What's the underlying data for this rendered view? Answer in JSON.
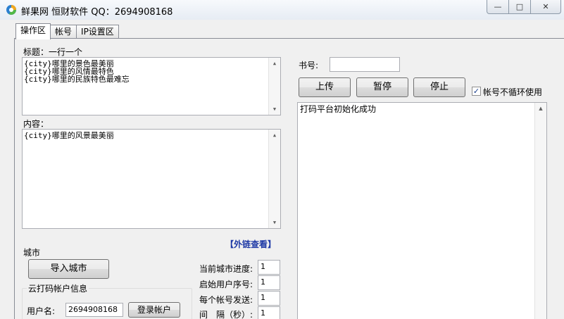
{
  "window": {
    "title": "鲜果网 恒财软件 QQ：2694908168",
    "minimize": "—",
    "maximize": "□",
    "close": "✕"
  },
  "tabs": [
    "操作区",
    "帐号",
    "IP设置区"
  ],
  "left": {
    "title_label": "标题：一行一个",
    "title_lines": [
      "{city}哪里的景色最美丽",
      "{city}哪里的风情最特色",
      "{city}哪里的民族特色最难忘"
    ],
    "content_label": "内容：",
    "content_lines": [
      "{city}哪里的风景最美丽"
    ],
    "external_link": "【外链查看】",
    "city_label": "城市",
    "import_city_button": "导入城市",
    "cloud_account_label": "云打码帐户信息",
    "username_label": "用户名:",
    "username_value": "2694908168",
    "login_button": "登录帐户",
    "progress_label": "当前城市进度:",
    "progress_value": "1",
    "start_user_label": "启始用户序号:",
    "start_user_value": "1",
    "per_account_label": "每个帐号发送:",
    "per_account_value": "1",
    "interval_label": "间　隔（秒）:",
    "interval_value": "1"
  },
  "right": {
    "book_label": "书号:",
    "book_value": "",
    "upload_button": "上传",
    "pause_button": "暂停",
    "stop_button": "停止",
    "no_loop_label": "帐号不循环使用",
    "no_loop_checked": true,
    "log_lines": [
      "打码平台初始化成功"
    ]
  }
}
